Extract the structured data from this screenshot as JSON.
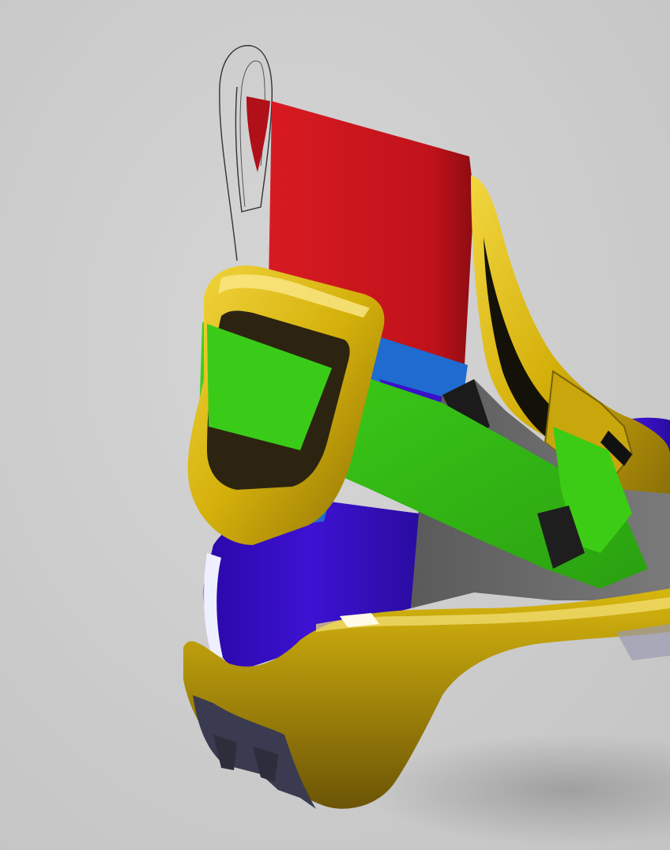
{
  "scene": {
    "subject": "shoe-render",
    "colors": {
      "background": "#cfcfcf",
      "heel_tab_red": "#c5141c",
      "collar_blue": "#1f6bd0",
      "upper_purple": "#3a10c8",
      "strap_green": "#36c414",
      "shell_yellow": "#d9b80c",
      "panel_gray": "#6b6b6b",
      "sole_dark": "#34344a"
    }
  }
}
